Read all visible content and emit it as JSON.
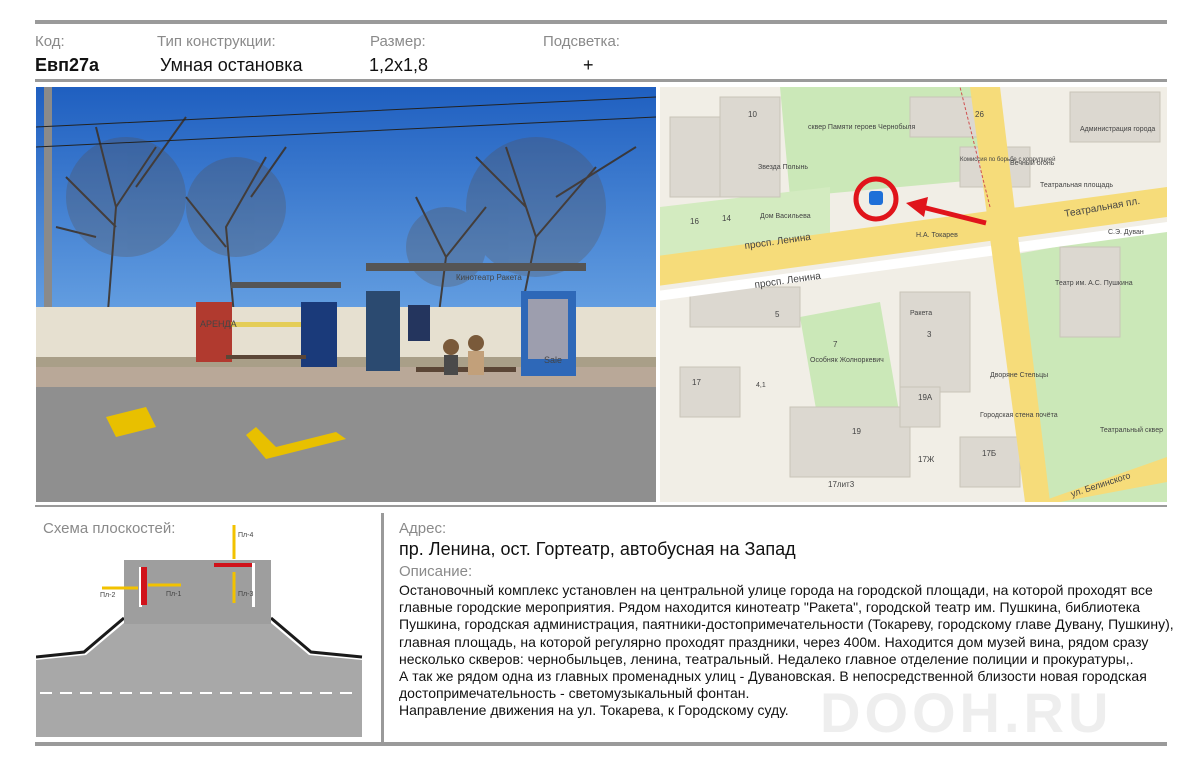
{
  "header": {
    "code_label": "Код:",
    "code_value": "Евп27а",
    "type_label": "Тип конструкции:",
    "type_value": "Умная остановка",
    "size_label": "Размер:",
    "size_value": "1,2x1,8",
    "light_label": "Подсветка:",
    "light_value": "+"
  },
  "photo": {
    "shelter_sign": "Кинотеатр Ракета",
    "left_poster": "АРЕНДА",
    "right_poster": "Sale"
  },
  "map": {
    "labels": {
      "park_chernobyl": "сквер Памяти героев Чернобыля",
      "zvezda": "Звезда Полынь",
      "dom_vasilieva": "Дом Васильева",
      "prosp_lenina_1": "просп. Ленина",
      "prosp_lenina_2": "просп. Ленина",
      "tokarev": "Н.А. Токарев",
      "teatr_square": "Театральная площадь",
      "teatr_pl": "Театральная пл.",
      "vechny_ogon": "Вечный огонь",
      "komissiya": "Комиссия по борьбе с коррупцией",
      "admin": "Администрация города",
      "duvan": "С.Э. Дуван",
      "teatr_pushkin": "Театр им. А.С. Пушкина",
      "raketa": "Ракета",
      "osobnyak": "Особняк Жолноркевич",
      "dvorjane": "Дворяне Стельцы",
      "gorod_stena": "Городская стена почёта",
      "teatr_skver": "Театральный сквер",
      "ul_belinskogo": "ул. Белинского",
      "b10": "10",
      "b16": "16",
      "b14": "14",
      "b26": "26",
      "b5": "5",
      "b3": "3",
      "b7": "7",
      "b17": "17",
      "b19": "19",
      "b19a": "19А",
      "b17zh": "17Ж",
      "b17b": "17Б",
      "b17lit": "17лит3",
      "b41": "4,1"
    }
  },
  "schema": {
    "title": "Схема плоскостей:",
    "planes": [
      "Пл-1",
      "Пл-2",
      "Пл-3",
      "Пл-4"
    ]
  },
  "address": {
    "label": "Адрес:",
    "value": "пр. Ленина, ост. Гортеатр, автобусная на Запад"
  },
  "description": {
    "label": "Описание:",
    "lines": [
      "Остановочный комплекс установлен на центральной улице города на городской площади, на которой проходят все",
      "главные городские мероприятия. Рядом находится кинотеатр \"Ракета\", городской театр им. Пушкина, библиотека",
      "Пушкина, городская администрация, паятники-достопримечательности (Токареву, городскому главе Дувану, Пушкину),",
      "главная площадь, на которой регулярно проходят праздники, через 400м. Находится дом музей вина, рядом сразу",
      "несколько скверов: чернобыльцев, ленина, театральный. Недалеко главное отделение полиции и прокуратуры,.",
      "А так же рядом одна из главных променадных улиц - Дувановская. В непосредственной близости новая городская",
      "достопримечательность -  светомузыкальный фонтан.",
      "Направление движения на ул. Токарева, к Городскому суду."
    ]
  },
  "watermark": "DOOH.RU",
  "colors": {
    "rule": "#9a9a9a",
    "marker_red": "#e0141b",
    "plane_red": "#d0121a",
    "arrow_yellow": "#f2c200",
    "asphalt": "#a8a8a8",
    "road_yellow": "#f6dc7a"
  }
}
